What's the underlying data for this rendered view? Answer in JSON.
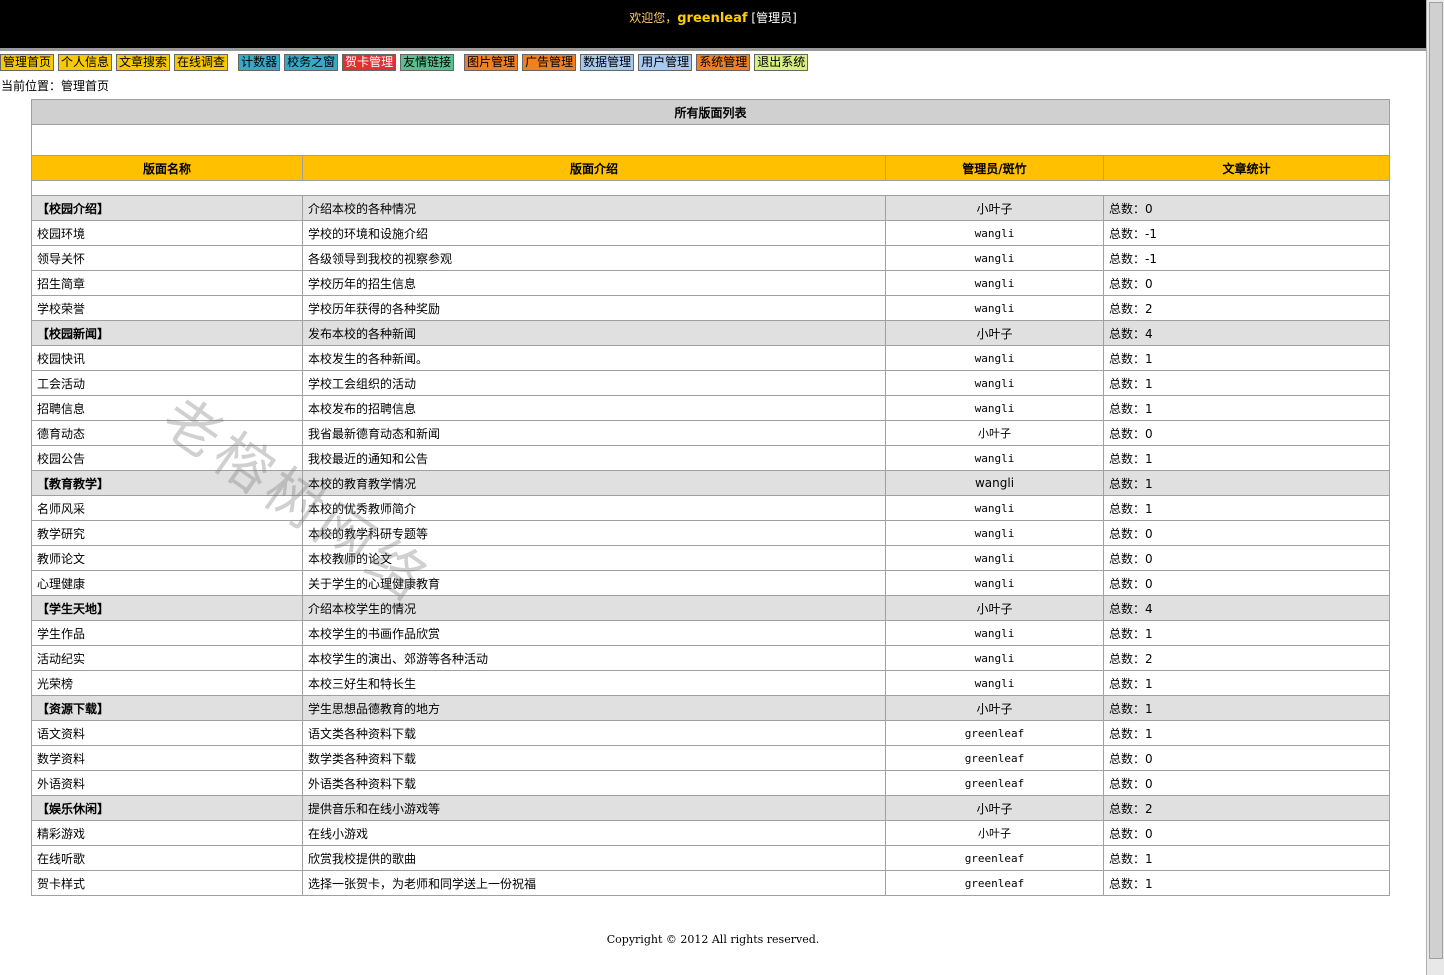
{
  "header": {
    "welcome_text": "欢迎您，",
    "username": "greenleaf",
    "role": "[管理员]"
  },
  "nav": [
    {
      "label": "管理首页",
      "color": "yellow"
    },
    {
      "label": "个人信息",
      "color": "yellow"
    },
    {
      "label": "文章搜索",
      "color": "yellow"
    },
    {
      "label": "在线调查",
      "color": "yellow"
    },
    {
      "label": "计数器",
      "color": "blue"
    },
    {
      "label": "校务之窗",
      "color": "blue"
    },
    {
      "label": "贺卡管理",
      "color": "red"
    },
    {
      "label": "友情链接",
      "color": "green"
    },
    {
      "label": "图片管理",
      "color": "orange"
    },
    {
      "label": "广告管理",
      "color": "orange"
    },
    {
      "label": "数据管理",
      "color": "lightblue"
    },
    {
      "label": "用户管理",
      "color": "lightblue"
    },
    {
      "label": "系统管理",
      "color": "orange"
    },
    {
      "label": "退出系统",
      "color": "yellowgreen"
    }
  ],
  "breadcrumb": "当前位置：管理首页",
  "table": {
    "title": "所有版面列表",
    "headers": [
      "版面名称",
      "版面介绍",
      "管理员/斑竹",
      "文章统计"
    ],
    "rows": [
      {
        "category": true,
        "name": "【校园介绍】",
        "desc": "介绍本校的各种情况",
        "admin": "小叶子",
        "count": "总数：0"
      },
      {
        "category": false,
        "name": "校园环境",
        "desc": "学校的环境和设施介绍",
        "admin": "wangli",
        "count": "总数：-1"
      },
      {
        "category": false,
        "name": "领导关怀",
        "desc": "各级领导到我校的视察参观",
        "admin": "wangli",
        "count": "总数：-1"
      },
      {
        "category": false,
        "name": "招生简章",
        "desc": "学校历年的招生信息",
        "admin": "wangli",
        "count": "总数：0"
      },
      {
        "category": false,
        "name": "学校荣誉",
        "desc": "学校历年获得的各种奖励",
        "admin": "wangli",
        "count": "总数：2"
      },
      {
        "category": true,
        "name": "【校园新闻】",
        "desc": "发布本校的各种新闻",
        "admin": "小叶子",
        "count": "总数：4"
      },
      {
        "category": false,
        "name": "校园快讯",
        "desc": "本校发生的各种新闻。",
        "admin": "wangli",
        "count": "总数：1"
      },
      {
        "category": false,
        "name": "工会活动",
        "desc": "学校工会组织的活动",
        "admin": "wangli",
        "count": "总数：1"
      },
      {
        "category": false,
        "name": "招聘信息",
        "desc": "本校发布的招聘信息",
        "admin": "wangli",
        "count": "总数：1"
      },
      {
        "category": false,
        "name": "德育动态",
        "desc": "我省最新德育动态和新闻",
        "admin": "小叶子",
        "count": "总数：0"
      },
      {
        "category": false,
        "name": "校园公告",
        "desc": "我校最近的通知和公告",
        "admin": "wangli",
        "count": "总数：1"
      },
      {
        "category": true,
        "name": "【教育教学】",
        "desc": "本校的教育教学情况",
        "admin": "wangli",
        "count": "总数：1"
      },
      {
        "category": false,
        "name": "名师风采",
        "desc": "本校的优秀教师简介",
        "admin": "wangli",
        "count": "总数：1"
      },
      {
        "category": false,
        "name": "教学研究",
        "desc": "本校的教学科研专题等",
        "admin": "wangli",
        "count": "总数：0"
      },
      {
        "category": false,
        "name": "教师论文",
        "desc": "本校教师的论文",
        "admin": "wangli",
        "count": "总数：0"
      },
      {
        "category": false,
        "name": "心理健康",
        "desc": "关于学生的心理健康教育",
        "admin": "wangli",
        "count": "总数：0"
      },
      {
        "category": true,
        "name": "【学生天地】",
        "desc": "介绍本校学生的情况",
        "admin": "小叶子",
        "count": "总数：4"
      },
      {
        "category": false,
        "name": "学生作品",
        "desc": "本校学生的书画作品欣赏",
        "admin": "wangli",
        "count": "总数：1"
      },
      {
        "category": false,
        "name": "活动纪实",
        "desc": "本校学生的演出、郊游等各种活动",
        "admin": "wangli",
        "count": "总数：2"
      },
      {
        "category": false,
        "name": "光荣榜",
        "desc": "本校三好生和特长生",
        "admin": "wangli",
        "count": "总数：1"
      },
      {
        "category": true,
        "name": "【资源下载】",
        "desc": "学生思想品德教育的地方",
        "admin": "小叶子",
        "count": "总数：1"
      },
      {
        "category": false,
        "name": "语文资料",
        "desc": "语文类各种资料下载",
        "admin": "greenleaf",
        "count": "总数：1"
      },
      {
        "category": false,
        "name": "数学资料",
        "desc": "数学类各种资料下载",
        "admin": "greenleaf",
        "count": "总数：0"
      },
      {
        "category": false,
        "name": "外语资料",
        "desc": "外语类各种资料下载",
        "admin": "greenleaf",
        "count": "总数：0"
      },
      {
        "category": true,
        "name": "【娱乐休闲】",
        "desc": "提供音乐和在线小游戏等",
        "admin": "小叶子",
        "count": "总数：2"
      },
      {
        "category": false,
        "name": "精彩游戏",
        "desc": "在线小游戏",
        "admin": "小叶子",
        "count": "总数：0"
      },
      {
        "category": false,
        "name": "在线听歌",
        "desc": "欣赏我校提供的歌曲",
        "admin": "greenleaf",
        "count": "总数：1"
      },
      {
        "category": false,
        "name": "贺卡样式",
        "desc": "选择一张贺卡，为老师和同学送上一份祝福",
        "admin": "greenleaf",
        "count": "总数：1"
      }
    ]
  },
  "footer": "Copyright © 2012 All rights reserved.",
  "watermark": "老榕树网络"
}
